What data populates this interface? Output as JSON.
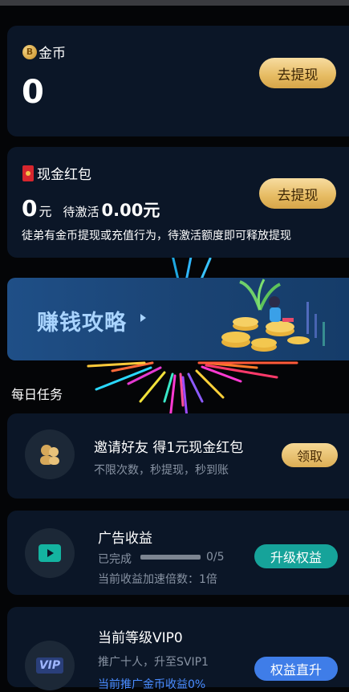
{
  "coin_card": {
    "title": "金币",
    "coin_symbol": "B",
    "amount": "0",
    "withdraw_label": "去提现"
  },
  "cash_card": {
    "title": "现金红包",
    "amount": "0",
    "unit": "元",
    "pending_label": "待激活",
    "pending_amount": "0.00元",
    "note": "徒弟有金币提现或充值行为，待激活额度即可释放提现",
    "withdraw_label": "去提现"
  },
  "banner": {
    "title": "赚钱攻略"
  },
  "daily_tasks": {
    "title": "每日任务",
    "invite": {
      "title": "邀请好友 得1元现金红包",
      "subtitle": "不限次数，秒提现，秒到账",
      "button": "领取"
    },
    "ad": {
      "title": "广告收益",
      "done_label": "已完成",
      "progress_text": "0/5",
      "progress": 0,
      "multiplier": "当前收益加速倍数：1倍",
      "button": "升级权益"
    },
    "vip": {
      "title": "当前等级VIP0",
      "icon_text": "VIP",
      "subtitle": "推广十人，升至SVIP1",
      "bonus": "当前推广金币收益0%",
      "button": "权益直升"
    }
  },
  "colors": {
    "background": "#040507",
    "card": "#0b1627",
    "gold_button": "#e6bb62",
    "teal_button": "#16a39a",
    "blue_button": "#3f7de8",
    "banner_text": "#a9d4ff",
    "link_blue": "#4a8cff"
  }
}
